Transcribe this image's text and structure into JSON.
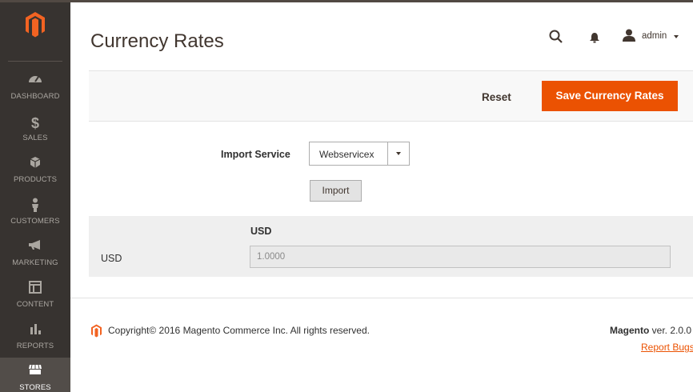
{
  "sidebar": {
    "items": [
      {
        "label": "DASHBOARD",
        "icon": "dashboard-icon"
      },
      {
        "label": "SALES",
        "icon": "dollar-icon"
      },
      {
        "label": "PRODUCTS",
        "icon": "box-icon"
      },
      {
        "label": "CUSTOMERS",
        "icon": "person-icon"
      },
      {
        "label": "MARKETING",
        "icon": "megaphone-icon"
      },
      {
        "label": "CONTENT",
        "icon": "layout-icon"
      },
      {
        "label": "REPORTS",
        "icon": "bar-chart-icon"
      },
      {
        "label": "STORES",
        "icon": "store-icon",
        "active": true
      }
    ]
  },
  "header": {
    "title": "Currency Rates",
    "user": "admin"
  },
  "actions": {
    "reset": "Reset",
    "save": "Save Currency Rates"
  },
  "form": {
    "import_label": "Import Service",
    "import_value": "Webservicex",
    "import_button": "Import"
  },
  "rates": {
    "column": "USD",
    "row": "USD",
    "value": "1.0000"
  },
  "footer": {
    "copyright": "Copyright© 2016 Magento Commerce Inc. All rights reserved.",
    "brand": "Magento",
    "version": " ver. 2.0.0",
    "report": "Report Bugs"
  },
  "colors": {
    "accent": "#eb5202",
    "sidebar": "#373330"
  }
}
